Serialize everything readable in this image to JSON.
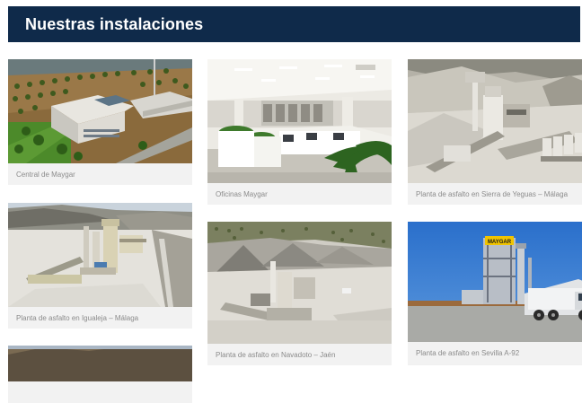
{
  "section_title": "Nuestras instalaciones",
  "cards": [
    {
      "caption": "Central de Maygar"
    },
    {
      "caption": "Oficinas Maygar"
    },
    {
      "caption": "Planta de asfalto en Sierra de Yeguas – Málaga"
    },
    {
      "caption": "Planta de asfalto en Igualeja – Málaga"
    },
    {
      "caption": "Planta de asfalto en Navadoto – Jaén"
    },
    {
      "caption": "Planta de asfalto en Sevilla A-92"
    },
    {
      "caption": ""
    }
  ],
  "signage": {
    "maygar_sign": "MAYGAR"
  },
  "colors": {
    "header_bg": "#0f2a4a",
    "caption_text": "#8b8b8b",
    "caption_bg": "#f2f2f2"
  }
}
